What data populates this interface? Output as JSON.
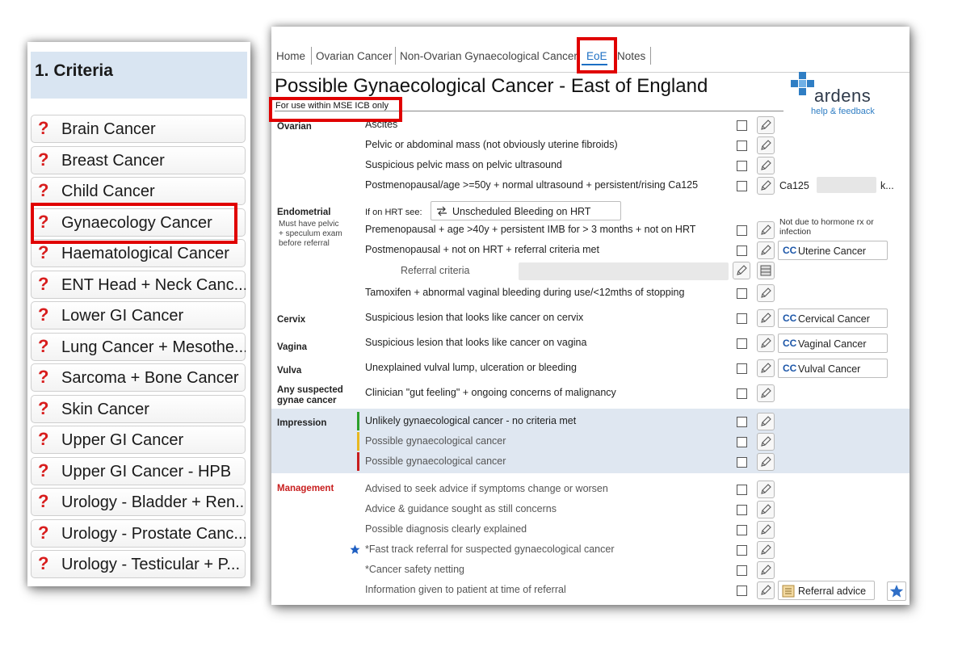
{
  "left_panel": {
    "header": "1. Criteria",
    "items": [
      {
        "label": "Brain Cancer"
      },
      {
        "label": "Breast Cancer"
      },
      {
        "label": "Child Cancer"
      },
      {
        "label": "Gynaecology Cancer"
      },
      {
        "label": "Haematological Cancer"
      },
      {
        "label": "ENT Head + Neck Canc..."
      },
      {
        "label": "Lower GI Cancer"
      },
      {
        "label": "Lung Cancer + Mesothe..."
      },
      {
        "label": "Sarcoma + Bone Cancer"
      },
      {
        "label": "Skin Cancer"
      },
      {
        "label": "Upper GI Cancer"
      },
      {
        "label": "Upper GI Cancer - HPB"
      },
      {
        "label": "Urology - Bladder + Ren..."
      },
      {
        "label": "Urology - Prostate Canc..."
      },
      {
        "label": "Urology - Testicular + P..."
      }
    ],
    "highlighted_item": "Gynaecology Cancer"
  },
  "tabs": [
    {
      "label": "Home"
    },
    {
      "label": "Ovarian Cancer"
    },
    {
      "label": "Non-Ovarian Gynaecological Cancer"
    },
    {
      "label": "EoE",
      "active": true
    },
    {
      "label": "Notes"
    }
  ],
  "page": {
    "title": "Possible Gynaecological Cancer - East of England",
    "subtitle": "For use within MSE ICB only"
  },
  "brand": {
    "name": "ardens",
    "help": "help & feedback",
    "color": "#2f7ec4"
  },
  "sections": {
    "ovarian": "Ovarian",
    "endometrial": "Endometrial",
    "endometrial_note": [
      "Must have pelvic",
      "+ speculum exam",
      "before referral"
    ],
    "cervix": "Cervix",
    "vagina": "Vagina",
    "vulva": "Vulva",
    "any_suspected": [
      "Any suspected",
      "gynae cancer"
    ],
    "impression": "Impression",
    "management": "Management"
  },
  "rows": {
    "ascites": "Ascites",
    "pelvic_mass": "Pelvic or abdominal mass (not obviously uterine fibroids)",
    "pelvic_us": "Suspicious pelvic mass on pelvic ultrasound",
    "postmeno_ca125": "Postmenopausal/age >=50y + normal ultrasound + persistent/rising Ca125",
    "ca125_label": "Ca125",
    "ca125_unit": "k...",
    "hrt_label": "If on HRT see:",
    "hrt_button": "Unscheduled Bleeding on HRT",
    "premeno": "Premenopausal + age >40y + persistent IMB for > 3 months + not on HRT",
    "premeno_note": "Not due to hormone rx or infection",
    "postmeno_not_hrt": "Postmenopausal + not on HRT + referral criteria met",
    "uterine_btn": "Uterine Cancer",
    "referral_criteria": "Referral criteria",
    "tamoxifen": "Tamoxifen + abnormal vaginal bleeding during use/<12mths of stopping",
    "cervix_lesion": "Suspicious lesion that looks like cancer on cervix",
    "cervical_btn": "Cervical Cancer",
    "vagina_lesion": "Suspicious lesion that looks like cancer on vagina",
    "vaginal_btn": "Vaginal Cancer",
    "vulva_lump": "Unexplained vulval lump, ulceration or bleeding",
    "vulval_btn": "Vulval Cancer",
    "gut_feeling": "Clinician \"gut feeling\" + ongoing concerns of malignancy",
    "imp_unlikely": "Unlikely gynaecological cancer - no criteria met",
    "imp_possible_amber": "Possible gynaecological cancer",
    "imp_possible_red": "Possible gynaecological cancer",
    "mgmt_advised": "Advised to seek advice if symptoms change or worsen",
    "mgmt_guidance": "Advice & guidance sought as still concerns",
    "mgmt_diagnosis": "Possible diagnosis clearly explained",
    "mgmt_fasttrack": "*Fast track referral for suspected gynaecological cancer",
    "mgmt_safety": "*Cancer safety netting",
    "mgmt_info": "Information given to patient at time of referral",
    "referral_advice_btn": "Referral advice"
  },
  "colors": {
    "highlight": "#e00000",
    "impression_green": "#2ca02c",
    "impression_amber": "#e8b820",
    "impression_red": "#c81e1e",
    "management_label": "#c81e1e",
    "impression_band": "#dfe7f1"
  }
}
